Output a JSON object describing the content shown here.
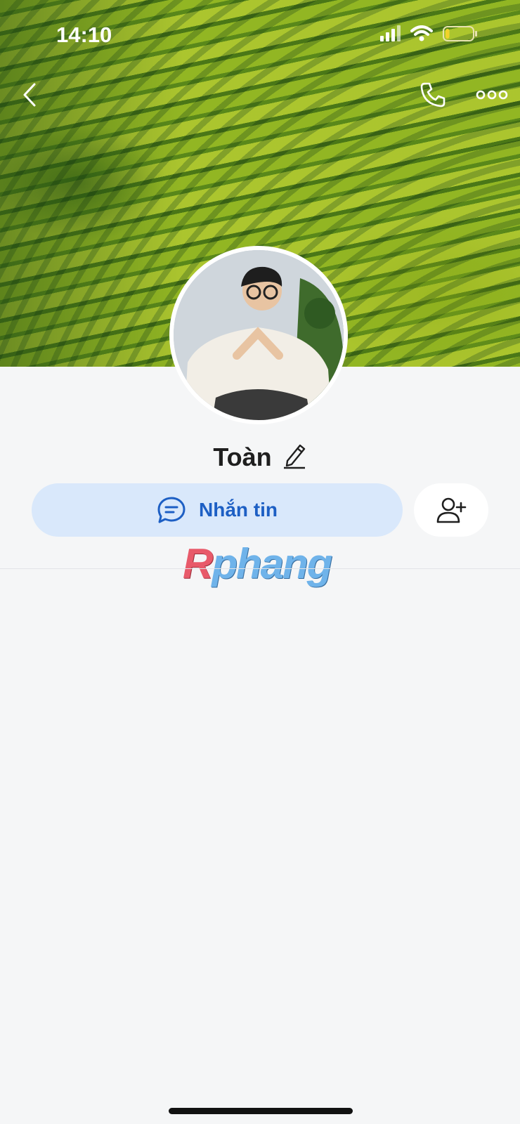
{
  "status_bar": {
    "time": "14:10",
    "battery_level": 0.15
  },
  "header": {
    "back_icon": "chevron-left-icon",
    "call_icon": "phone-icon",
    "more_icon": "more-dots-icon"
  },
  "profile": {
    "name": "Toàn",
    "edit_icon": "pencil-icon"
  },
  "actions": {
    "message_label": "Nhắn tin",
    "message_icon": "chat-bubble-icon",
    "add_friend_icon": "add-user-icon"
  },
  "watermark": {
    "first_letter": "R",
    "rest": "phang"
  },
  "colors": {
    "accent": "#1d5fc4",
    "message_bg": "#d9e8fb",
    "page_bg": "#f5f6f7"
  }
}
